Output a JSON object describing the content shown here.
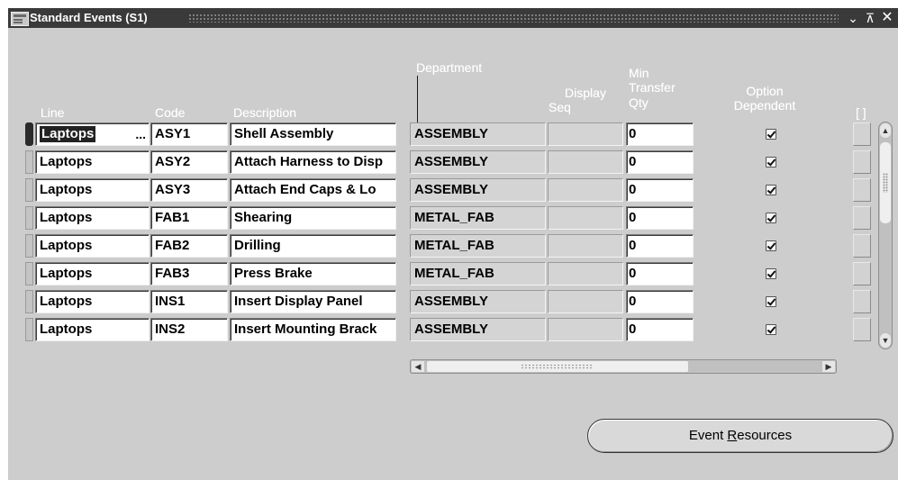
{
  "window": {
    "title": "Standard Events (S1)"
  },
  "columns": {
    "line": "Line",
    "code": "Code",
    "description": "Description",
    "department": "Department",
    "display_seq_1": "Display",
    "display_seq_2": "Seq",
    "min_transfer_1": "Min",
    "min_transfer_2": "Transfer",
    "min_transfer_3": "Qty",
    "option_dependent_1": "Option",
    "option_dependent_2": "Dependent",
    "flex": "[ ]"
  },
  "rows": [
    {
      "line": "Laptops",
      "code": "ASY1",
      "description": "Shell Assembly",
      "department": "ASSEMBLY",
      "display_seq": "",
      "min_transfer_qty": "0",
      "option_dependent": true
    },
    {
      "line": "Laptops",
      "code": "ASY2",
      "description": "Attach Harness to Disp",
      "department": "ASSEMBLY",
      "display_seq": "",
      "min_transfer_qty": "0",
      "option_dependent": true
    },
    {
      "line": "Laptops",
      "code": "ASY3",
      "description": "Attach End Caps & Lo",
      "department": "ASSEMBLY",
      "display_seq": "",
      "min_transfer_qty": "0",
      "option_dependent": true
    },
    {
      "line": "Laptops",
      "code": "FAB1",
      "description": "Shearing",
      "department": "METAL_FAB",
      "display_seq": "",
      "min_transfer_qty": "0",
      "option_dependent": true
    },
    {
      "line": "Laptops",
      "code": "FAB2",
      "description": "Drilling",
      "department": "METAL_FAB",
      "display_seq": "",
      "min_transfer_qty": "0",
      "option_dependent": true
    },
    {
      "line": "Laptops",
      "code": "FAB3",
      "description": "Press Brake",
      "department": "METAL_FAB",
      "display_seq": "",
      "min_transfer_qty": "0",
      "option_dependent": true
    },
    {
      "line": "Laptops",
      "code": "INS1",
      "description": "Insert Display Panel",
      "department": "ASSEMBLY",
      "display_seq": "",
      "min_transfer_qty": "0",
      "option_dependent": true
    },
    {
      "line": "Laptops",
      "code": "INS2",
      "description": "Insert Mounting Brack",
      "department": "ASSEMBLY",
      "display_seq": "",
      "min_transfer_qty": "0",
      "option_dependent": true
    }
  ],
  "lov_indicator": "...",
  "buttons": {
    "event_resources_pre": "Event ",
    "event_resources_mnemonic": "R",
    "event_resources_post": "esources"
  },
  "icons": {
    "window": "oracle-forms-window-icon",
    "minimize": "minimize-icon",
    "maximize": "maximize-icon",
    "close": "close-icon",
    "checkbox": "checkbox-checked-icon"
  }
}
